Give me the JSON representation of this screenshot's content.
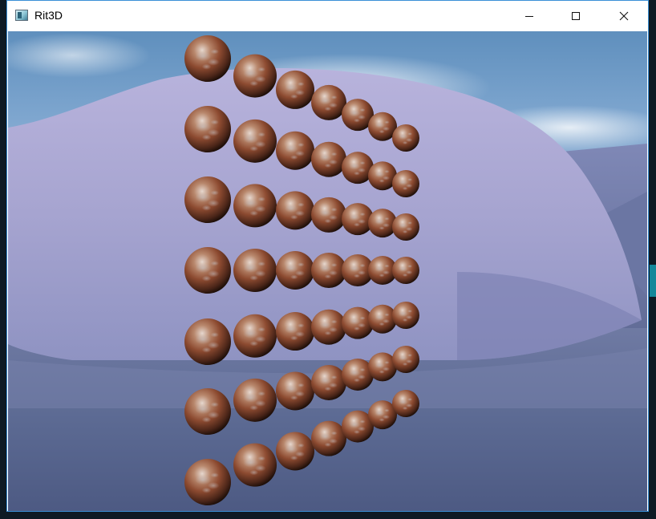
{
  "window": {
    "title": "Rit3D",
    "accent_border": "#3a8fd6"
  },
  "controls": {
    "minimize_icon": "minimize-icon",
    "maximize_icon": "maximize-icon",
    "close_icon": "close-icon"
  },
  "scene": {
    "sky_color": "#7ea6cf",
    "hill_color": "#a9a7d4",
    "ground_color": "#5c6a93",
    "sphere_material": "rusted-metal",
    "sphere_rows": 7,
    "spheres_per_row": 7
  }
}
